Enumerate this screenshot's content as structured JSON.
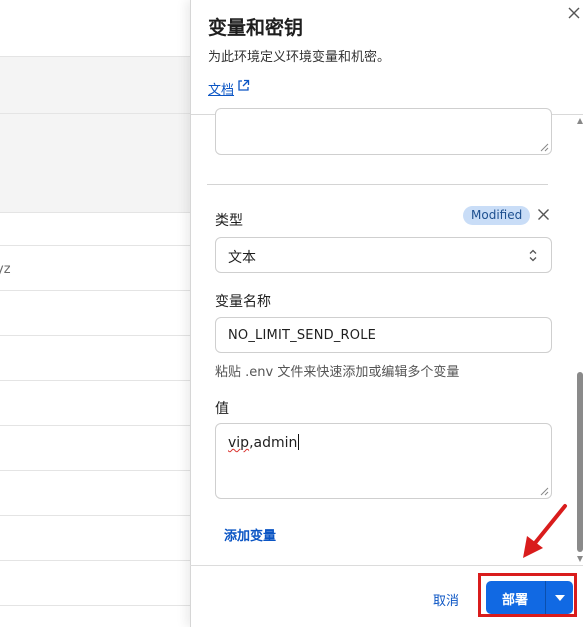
{
  "background": {
    "row_fragment": "yz"
  },
  "panel": {
    "title": "变量和密钥",
    "subtitle": "为此环境定义环境变量和机密。",
    "docs_link": "文档"
  },
  "form": {
    "badge": "Modified",
    "type_label": "类型",
    "type_value": "文本",
    "name_label": "变量名称",
    "name_value": "NO_LIMIT_SEND_ROLE",
    "hint": "粘贴 .env 文件来快速添加或编辑多个变量",
    "value_label": "值",
    "value_misspelled": "vip",
    "value_rest": ",admin",
    "add_variable": "添加变量"
  },
  "footer": {
    "cancel": "取消",
    "deploy": "部署"
  },
  "colors": {
    "accent": "#1169e3",
    "highlight": "#d91c1c",
    "badge_bg": "#c9ddf7"
  }
}
